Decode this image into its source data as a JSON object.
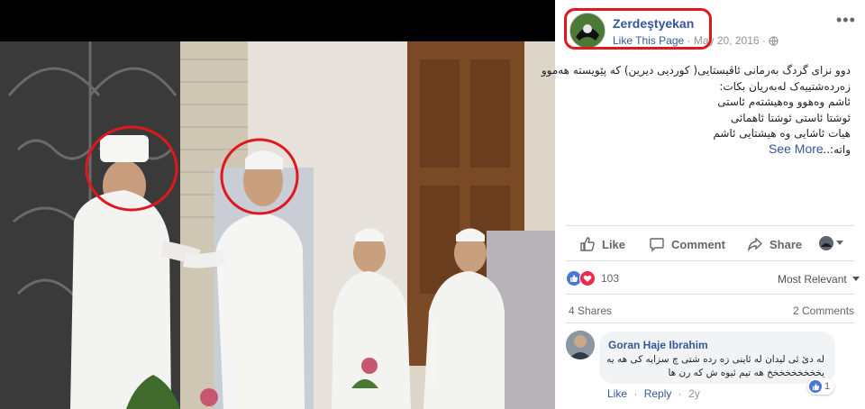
{
  "post": {
    "page_name": "Zerdeştyekan",
    "like_page": "Like This Page",
    "date": "May 20, 2016",
    "meta_sep": "·",
    "caption_lines": [
      "دوو نزای گردگ بەرمانی ئاڤیستایی( کوردیی دیرین) کە پێویستە هەموو",
      "زەردەشتییەک لەبەریان بکات:",
      "ئاشم وەهوو وەهیشتەم ئاستی",
      "ئوشتا ئاستی ئوشتا ئاهمائی",
      "هیات ئاشایی وە هیشتایی ئاشم",
      "واتە:..."
    ],
    "see_more": "See More",
    "more_options": "•••",
    "actions": {
      "like": "Like",
      "comment": "Comment",
      "share": "Share"
    },
    "reactions": {
      "count": "103"
    },
    "sort": "Most Relevant",
    "shares": "4 Shares",
    "comments_count": "2 Comments"
  },
  "comment": {
    "author": "Goran Haje Ibrahim",
    "text_lines": [
      "لە دێ ئی لیدان لە ئاینی زە ردە شتی چ سزایە کی هە یە",
      "یخخخخخخخخخ هە تیم ئیوە ش کە رن ها"
    ],
    "reaction_count": "1",
    "like": "Like",
    "reply": "Reply",
    "sep": "·",
    "time": "2y"
  },
  "colors": {
    "link": "#365899",
    "highlight": "#e0171c",
    "like_blue": "#4a76d8",
    "love_red": "#f0284a"
  },
  "icons": [
    "thumbs-up-icon",
    "comment-icon",
    "share-icon",
    "chevron-down-icon",
    "globe-icon",
    "more-options-icon",
    "like-reaction-icon",
    "love-reaction-icon"
  ]
}
